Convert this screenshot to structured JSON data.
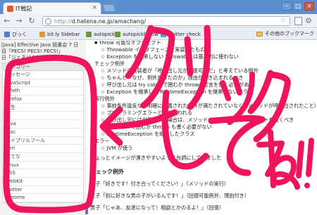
{
  "browser": {
    "tab_title": "IT戦記",
    "tab_close": "×",
    "new_tab": "",
    "window_controls": [
      "–",
      "□",
      "×"
    ],
    "url_scheme": "http://",
    "url_rest": "d.hatena.ne.jp/amachang/",
    "back": "←",
    "forward": "→",
    "reload": "↻",
    "star": "☆",
    "bookmarks": [
      {
        "label": "びっく",
        "color": "#4a7fd1"
      },
      {
        "label": "bit.ly Sidebar",
        "color": "#e09a2b"
      },
      {
        "label": "autopick",
        "color": "#6a9a3b"
      },
      {
        "label": "autopickfollow",
        "color": "#6a9a3b"
      },
      {
        "label": "twitter check",
        "color": "#45a6d8"
      }
    ],
    "other_bookmarks": "その他のブックマーク"
  },
  "sidebar": {
    "entries": [
      "[Java] Effective Java 読書会 7 日",
      "目「PECS! PECS! PECS!」",
      "日「ジェネリクス！」"
    ],
    "category_header": "カテゴリー",
    "categories": [
      "メッセージ",
      "JavaScript",
      "XPath",
      "Firefox",
      "人生",
      "IE",
      "Java",
      "Mac",
      "エイプリルフール",
      "Perl",
      "はてな",
      "Linux",
      "CSS",
      "WebKit",
      "Twitter",
      "Chrome"
    ]
  },
  "article": {
    "lines": [
      "throw 可能なオブジェクト",
      "Throwable インタフェースを実装したもの",
      "Exception を継承しない Throwable は基本的に使わない",
      "チェック例外",
      "メソッドの実装者が「呼び出し元が回復可能だ」と考えている例外",
      "ちゃんと「なぜ、例外だったのか」理由が書き込まれるべき",
      "呼び出し元は try catch で囲むか throws 宣言を書く必要がある",
      "Exception を継承して RuntimeException を継承しないクラス",
      "実行例外",
      "事前条件違反など明確に定義された条件が満たされていなくてメソッドが呼び出されたこと）",
      "プログラミングエラーとして使われる",
      "呼び出し元にはが発生する場合は、メソッドの呼び出しごとにコメントを書くべき",
      "try catch で囲むか throws も書く必要がない",
      "RuntimeException を継承したクラス",
      "エラー",
      "JVM が使う",
      "ちょっとイメージが湧きやすいように台詞にしてみました",
      "チェック例外",
      "男子「好きです！付き合ってください！」（メソッドの実行）",
      "女子「別に好きな男の子がいるんです！」（回復可能例外、理由付き）",
      "男子「じゃあ、友達になって！相談とかのるよ！」（回復）"
    ]
  },
  "overlay": {
    "handwriting": "クリックしてね!!",
    "ink_color": "#f0145a"
  }
}
